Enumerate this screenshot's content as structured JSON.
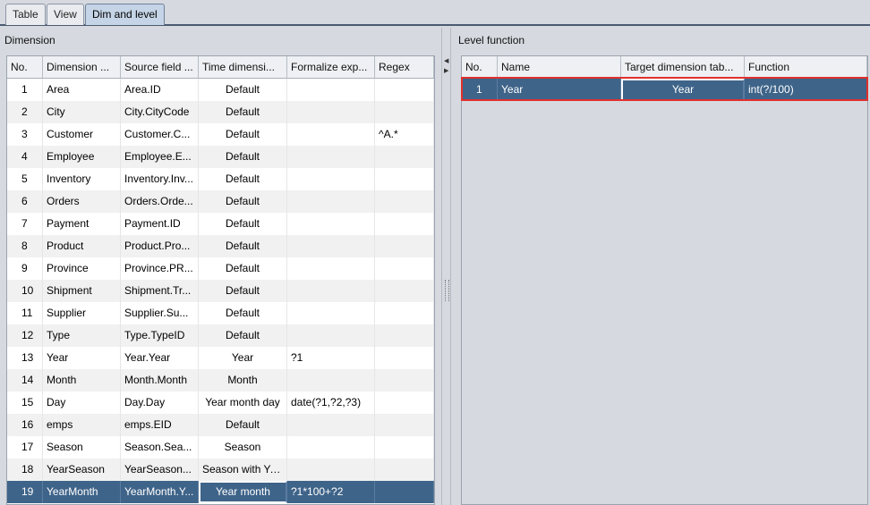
{
  "tabs": [
    {
      "label": "Table",
      "active": false
    },
    {
      "label": "View",
      "active": false
    },
    {
      "label": "Dim and level",
      "active": true
    }
  ],
  "dimension": {
    "title": "Dimension",
    "columns": [
      "No.",
      "Dimension ...",
      "Source field ...",
      "Time dimensi...",
      "Formalize exp...",
      "Regex"
    ],
    "rows": [
      [
        "1",
        "Area",
        "Area.ID",
        "Default",
        "",
        ""
      ],
      [
        "2",
        "City",
        "City.CityCode",
        "Default",
        "",
        ""
      ],
      [
        "3",
        "Customer",
        "Customer.C...",
        "Default",
        "",
        "^A.*"
      ],
      [
        "4",
        "Employee",
        "Employee.E...",
        "Default",
        "",
        ""
      ],
      [
        "5",
        "Inventory",
        "Inventory.Inv...",
        "Default",
        "",
        ""
      ],
      [
        "6",
        "Orders",
        "Orders.Orde...",
        "Default",
        "",
        ""
      ],
      [
        "7",
        "Payment",
        "Payment.ID",
        "Default",
        "",
        ""
      ],
      [
        "8",
        "Product",
        "Product.Pro...",
        "Default",
        "",
        ""
      ],
      [
        "9",
        "Province",
        "Province.PR...",
        "Default",
        "",
        ""
      ],
      [
        "10",
        "Shipment",
        "Shipment.Tr...",
        "Default",
        "",
        ""
      ],
      [
        "11",
        "Supplier",
        "Supplier.Su...",
        "Default",
        "",
        ""
      ],
      [
        "12",
        "Type",
        "Type.TypeID",
        "Default",
        "",
        ""
      ],
      [
        "13",
        "Year",
        "Year.Year",
        "Year",
        "?1",
        ""
      ],
      [
        "14",
        "Month",
        "Month.Month",
        "Month",
        "",
        ""
      ],
      [
        "15",
        "Day",
        "Day.Day",
        "Year month day",
        "date(?1,?2,?3)",
        ""
      ],
      [
        "16",
        "emps",
        "emps.EID",
        "Default",
        "",
        ""
      ],
      [
        "17",
        "Season",
        "Season.Sea...",
        "Season",
        "",
        ""
      ],
      [
        "18",
        "YearSeason",
        "YearSeason...",
        "Season with Year",
        "",
        ""
      ],
      [
        "19",
        "YearMonth",
        "YearMonth.Y...",
        "Year month",
        "?1*100+?2",
        ""
      ]
    ]
  },
  "level": {
    "title": "Level function",
    "columns": [
      "No.",
      "Name",
      "Target dimension tab...",
      "Function"
    ],
    "rows": [
      [
        "1",
        "Year",
        "Year",
        "int(?/100)"
      ]
    ]
  },
  "colors": {
    "selected_row": "#3f6489",
    "highlight_box": "#e0302d"
  }
}
